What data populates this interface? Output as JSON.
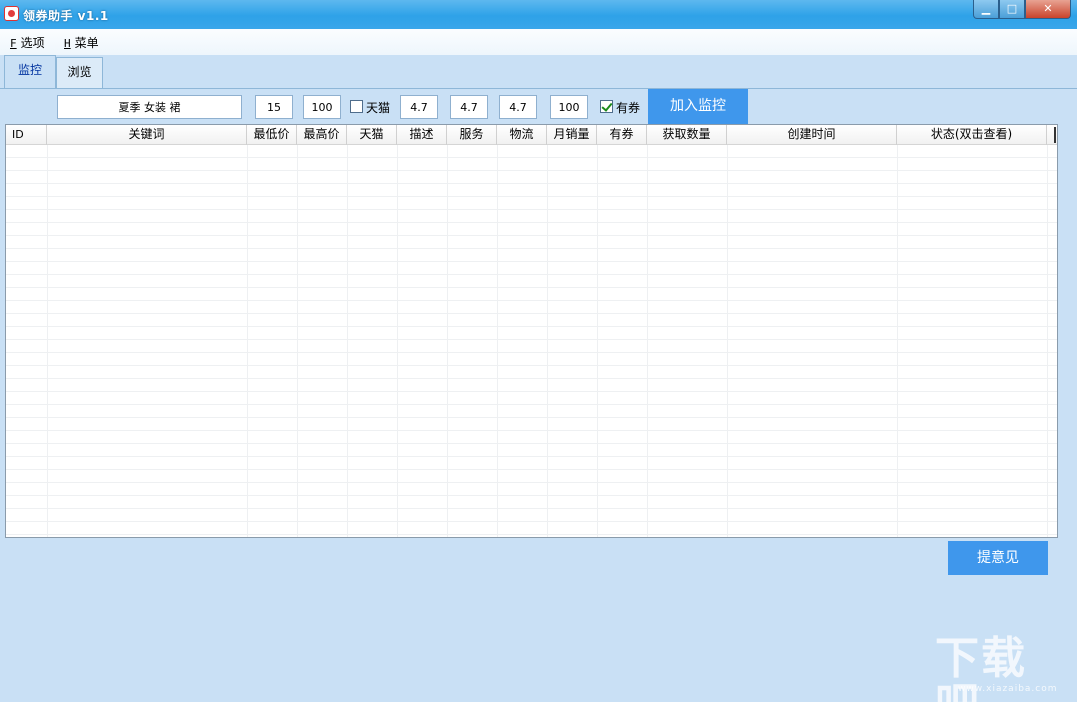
{
  "window": {
    "title": "领券助手 v1.1",
    "min_label": "▁",
    "max_label": "□",
    "close_label": "✕"
  },
  "menu": {
    "items": [
      {
        "key": "F",
        "label": "选项"
      },
      {
        "key": "H",
        "label": "菜单"
      }
    ]
  },
  "tabs": [
    {
      "label": "监控",
      "active": true
    },
    {
      "label": "浏览",
      "active": false
    }
  ],
  "form": {
    "keyword": "夏季 女装 裙",
    "min_price": "15",
    "max_price": "100",
    "tmall_label": "天猫",
    "tmall_checked": false,
    "desc_score": "4.7",
    "service_score": "4.7",
    "logistics_score": "4.7",
    "monthly_sales": "100",
    "coupon_label": "有券",
    "coupon_checked": true,
    "add_button": "加入监控"
  },
  "table": {
    "columns": [
      "ID",
      "关键词",
      "最低价",
      "最高价",
      "天猫",
      "描述",
      "服务",
      "物流",
      "月销量",
      "有券",
      "获取数量",
      "创建时间",
      "状态(双击查看)"
    ],
    "rows": []
  },
  "feedback_button": "提意见",
  "watermark": {
    "text": "下载吧",
    "url": "www.xiazaiba.com"
  },
  "colors": {
    "titlebar": "#2ea2e8",
    "background": "#c9e0f5",
    "accent_button": "#3f97ec"
  }
}
